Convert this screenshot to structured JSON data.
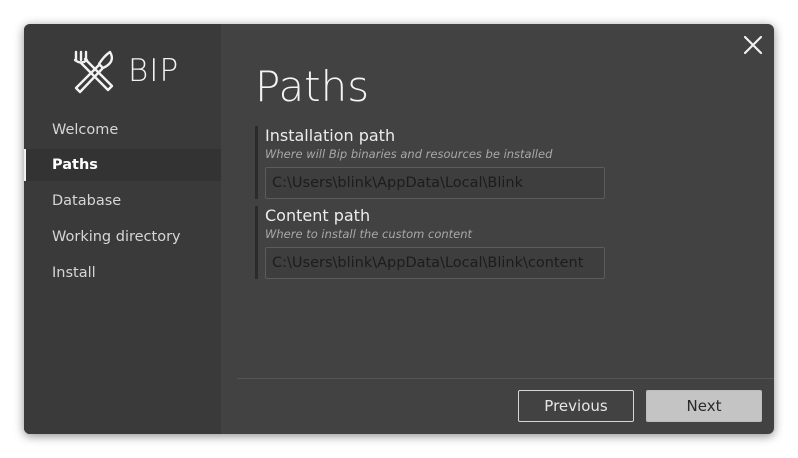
{
  "app": {
    "logo_text": "BIP"
  },
  "sidebar": {
    "items": [
      {
        "label": "Welcome"
      },
      {
        "label": "Paths"
      },
      {
        "label": "Database"
      },
      {
        "label": "Working directory"
      },
      {
        "label": "Install"
      }
    ],
    "active_index": 1
  },
  "page": {
    "title": "Paths"
  },
  "sections": [
    {
      "title": "Installation path",
      "subtitle": "Where will Bip binaries and resources be installed",
      "value": "C:\\Users\\blink\\AppData\\Local\\Blink"
    },
    {
      "title": "Content path",
      "subtitle": "Where to install the custom content",
      "value": "C:\\Users\\blink\\AppData\\Local\\Blink\\content"
    }
  ],
  "footer": {
    "previous_label": "Previous",
    "next_label": "Next"
  },
  "icons": {
    "logo": "crossed-tools-icon",
    "close": "close-icon"
  },
  "colors": {
    "window_bg": "#424242",
    "sidebar_bg": "#3a3a3a",
    "active_item_bg": "#333333",
    "next_button_bg": "#c4c4c4"
  }
}
